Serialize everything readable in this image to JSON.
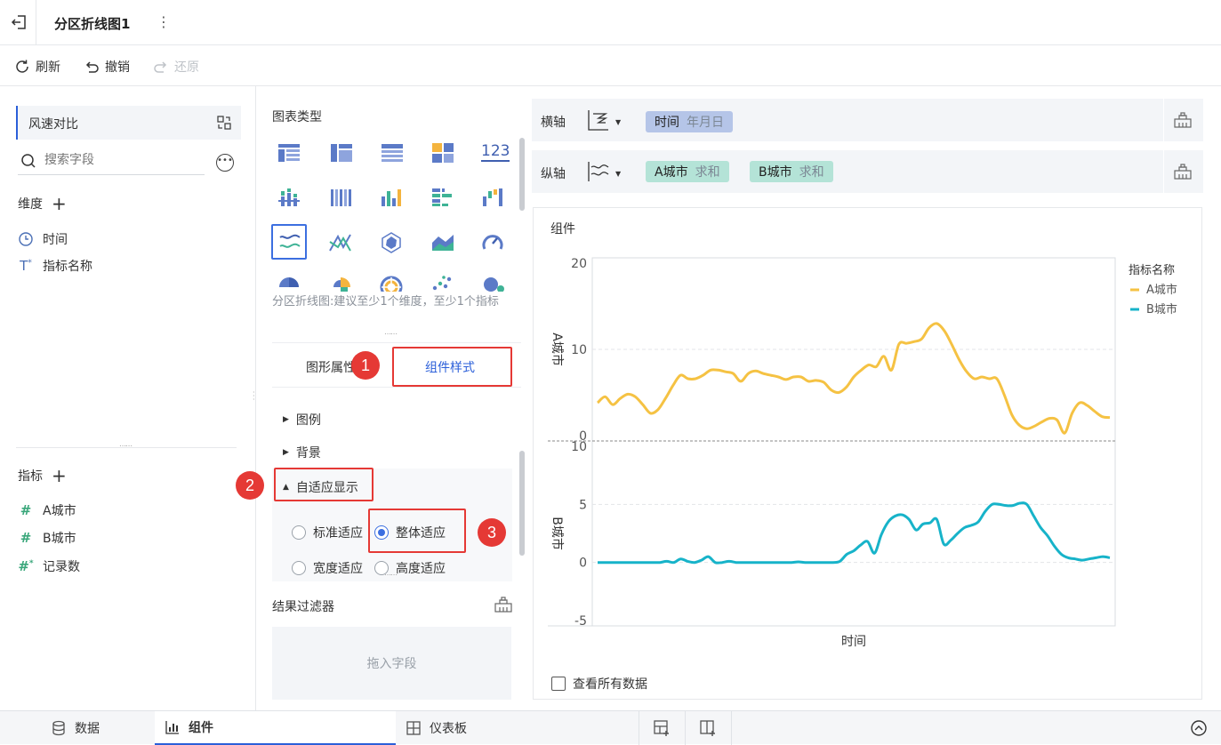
{
  "header": {
    "title": "分区折线图1",
    "more": "⋮"
  },
  "toolbar": {
    "refresh": "刷新",
    "undo": "撤销",
    "redo": "还原"
  },
  "left": {
    "dataset": "风速对比",
    "search_placeholder": "搜索字段",
    "dimension_label": "维度",
    "dimensions": [
      {
        "name": "时间"
      },
      {
        "name": "指标名称"
      }
    ],
    "measure_label": "指标",
    "measures": [
      {
        "name": "A城市"
      },
      {
        "name": "B城市"
      },
      {
        "name": "记录数"
      }
    ]
  },
  "mid": {
    "chart_type_title": "图表类型",
    "number_icon_text": "123",
    "hint": "分区折线图:建议至少1个维度，至少1个指标",
    "tabs": {
      "graph_attr": "图形属性",
      "component_style": "组件样式"
    },
    "sections": {
      "legend": "图例",
      "background": "背景",
      "adaptive": "自适应显示"
    },
    "options": {
      "standard": "标准适应",
      "whole": "整体适应",
      "width": "宽度适应",
      "height": "高度适应"
    },
    "filter_title": "结果过滤器",
    "drop_placeholder": "拖入字段"
  },
  "badges": {
    "b1": "1",
    "b2": "2",
    "b3": "3"
  },
  "axes": {
    "x_label": "横轴",
    "y_label": "纵轴",
    "x_chip": {
      "name": "时间",
      "sub": "年月日"
    },
    "y_chips": [
      {
        "name": "A城市",
        "sub": "求和"
      },
      {
        "name": "B城市",
        "sub": "求和"
      }
    ]
  },
  "chart_data": {
    "type": "line",
    "title": "组件",
    "xlabel": "时间",
    "legend_title": "指标名称",
    "legend_position": "right",
    "grid": true,
    "panels": [
      {
        "name": "A城市",
        "ylabel": "A城市",
        "ylim": [
          0,
          20
        ],
        "yticks": [
          0,
          10,
          20
        ],
        "color": "#f5c243",
        "values": [
          3.8,
          4.5,
          3.6,
          4.3,
          4.8,
          4.5,
          3.6,
          2.6,
          3.0,
          4.3,
          5.8,
          7.0,
          6.6,
          6.6,
          7.0,
          7.6,
          7.6,
          7.4,
          7.2,
          6.3,
          7.2,
          7.5,
          7.2,
          7.0,
          6.8,
          6.5,
          6.8,
          6.8,
          6.3,
          6.4,
          6.2,
          5.3,
          5.0,
          5.6,
          6.8,
          7.6,
          8.2,
          8.0,
          9.2,
          7.6,
          10.6,
          10.7,
          10.9,
          11.2,
          12.5,
          13.0,
          12.2,
          10.6,
          8.8,
          7.4,
          6.6,
          6.8,
          6.6,
          6.6,
          4.7,
          2.4,
          1.2,
          0.8,
          1.1,
          1.6,
          2.0,
          1.8,
          0.3,
          2.6,
          3.8,
          3.5,
          2.8,
          2.2,
          2.1
        ]
      },
      {
        "name": "B城市",
        "ylabel": "B城市",
        "ylim": [
          -5,
          10
        ],
        "yticks": [
          -5,
          0,
          5,
          10
        ],
        "color": "#17b3c9",
        "values": [
          0,
          0,
          0,
          0,
          0,
          0,
          0,
          0,
          0,
          0,
          0.1,
          0,
          0.3,
          0.1,
          0,
          0.2,
          0.5,
          0,
          0,
          0.1,
          0,
          0,
          0,
          0,
          0,
          0,
          0,
          0,
          0,
          0.05,
          0,
          0,
          0,
          0,
          0,
          0.1,
          0.7,
          1.0,
          1.5,
          1.8,
          0.8,
          2.4,
          3.5,
          4.0,
          4.1,
          3.7,
          2.8,
          3.3,
          3.4,
          3.7,
          1.6,
          1.9,
          2.5,
          3.0,
          3.2,
          3.5,
          4.4,
          5.0,
          5.0,
          4.9,
          4.9,
          5.1,
          5.0,
          4.0,
          3.0,
          2.3,
          1.4,
          0.7,
          0.4,
          0.3,
          0.2,
          0.3,
          0.4,
          0.5,
          0.4
        ]
      }
    ]
  },
  "legend": {
    "items": [
      {
        "name": "A城市",
        "color": "#f5c243"
      },
      {
        "name": "B城市",
        "color": "#17b3c9"
      }
    ]
  },
  "view_all": "查看所有数据",
  "bottom": {
    "data": "数据",
    "component": "组件",
    "dashboard": "仪表板"
  }
}
